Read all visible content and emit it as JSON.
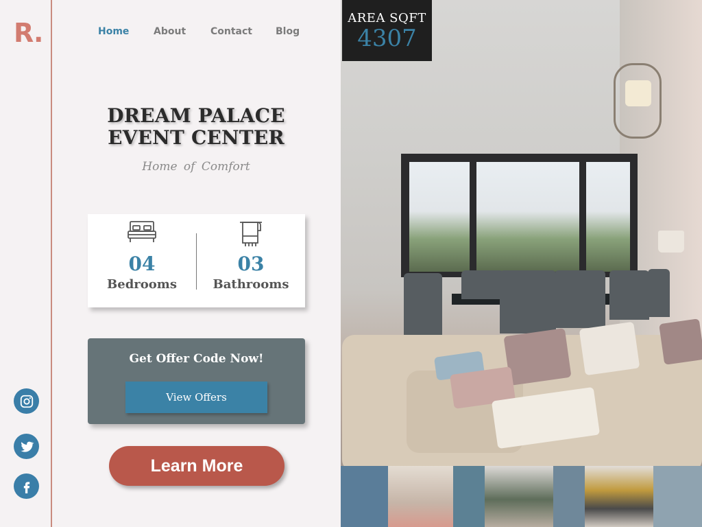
{
  "brand": {
    "logo": "R."
  },
  "nav": {
    "items": [
      {
        "label": "Home",
        "active": true
      },
      {
        "label": "About",
        "active": false
      },
      {
        "label": "Contact",
        "active": false
      },
      {
        "label": "Blog",
        "active": false
      }
    ]
  },
  "hero": {
    "title": "DREAM PALACE EVENT CENTER",
    "tagline": "Home of Comfort"
  },
  "stats": {
    "bedrooms": {
      "value": "04",
      "label": "Bedrooms",
      "icon": "bed-icon"
    },
    "bathrooms": {
      "value": "03",
      "label": "Bathrooms",
      "icon": "towel-icon"
    }
  },
  "offer": {
    "heading": "Get Offer Code Now!",
    "button": "View Offers"
  },
  "cta": {
    "learn_more": "Learn More"
  },
  "area": {
    "label": "AREA SQFT",
    "value": "4307"
  },
  "social": [
    "instagram-icon",
    "twitter-icon",
    "facebook-icon"
  ],
  "colors": {
    "accent": "#3b82a6",
    "brand": "#d27c70",
    "cta": "#b9584b",
    "panel": "#667478",
    "background": "#f5f2f3"
  }
}
